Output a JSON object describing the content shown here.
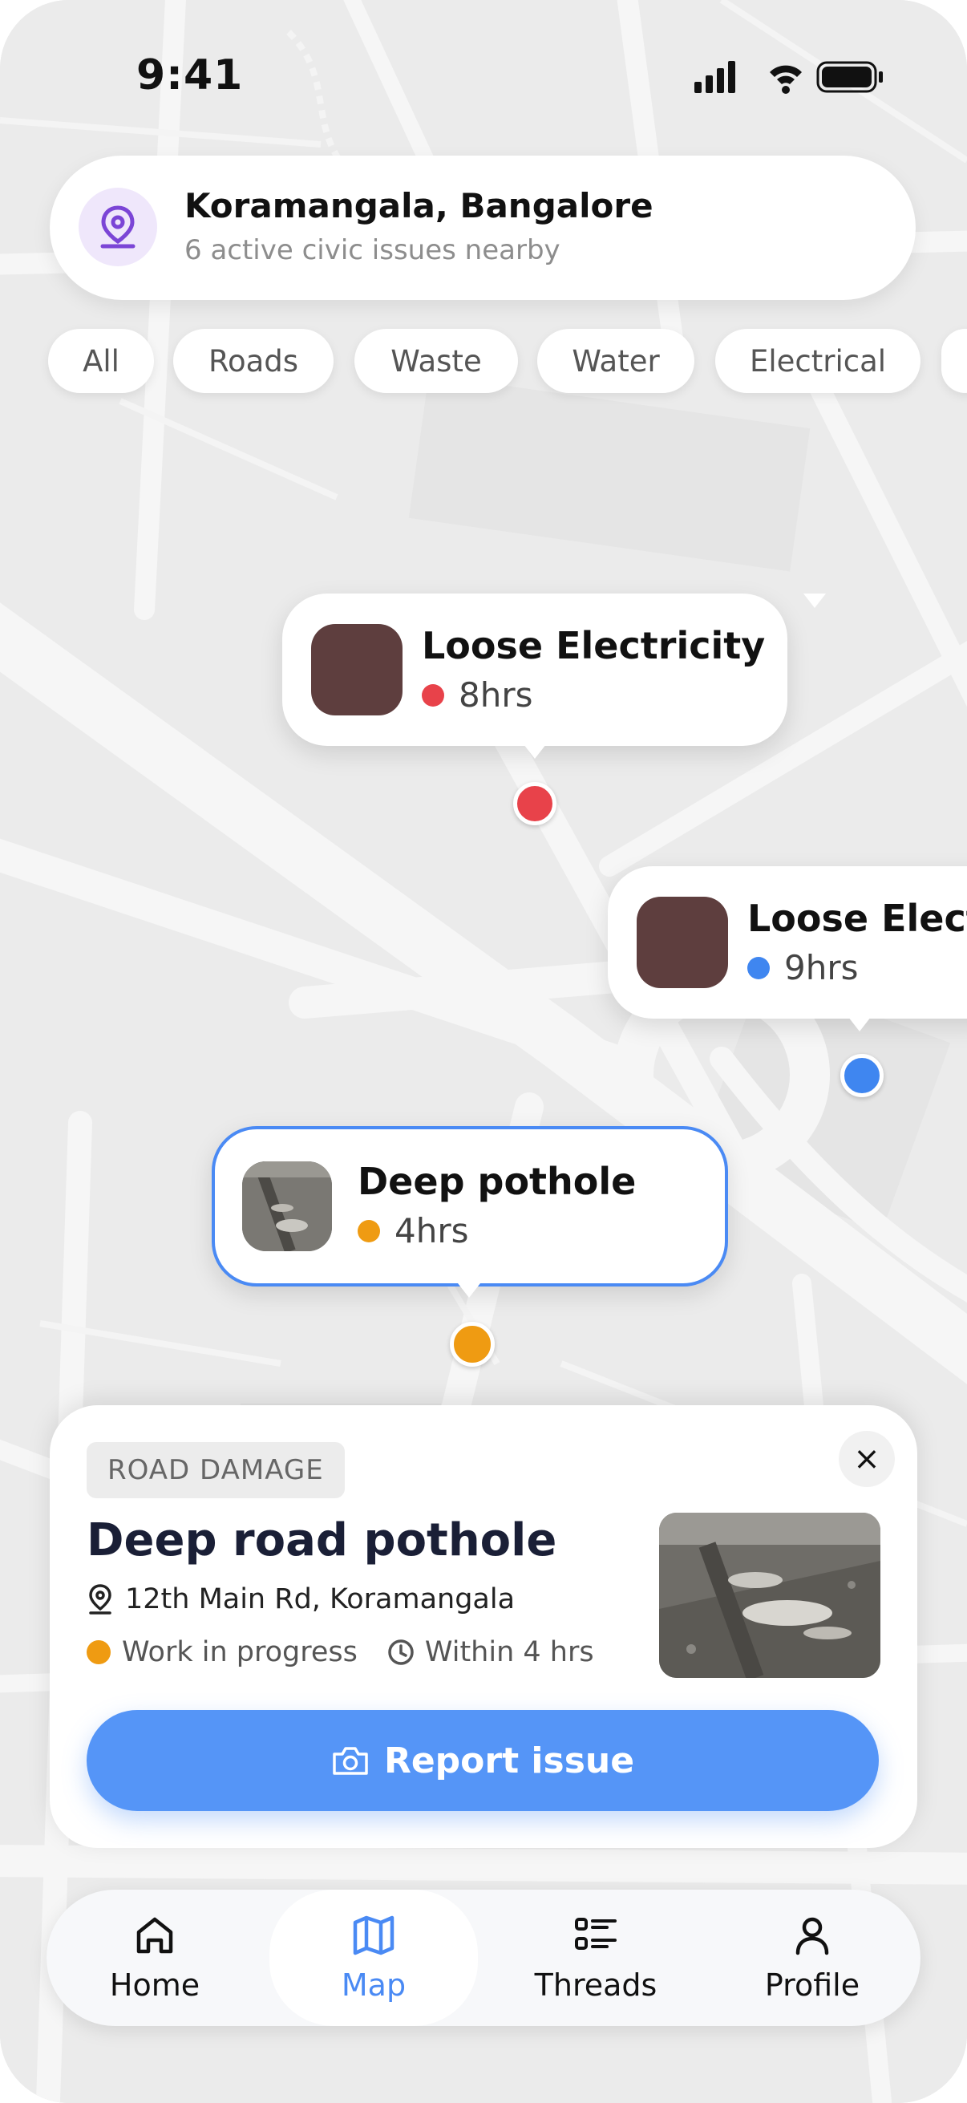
{
  "status_bar": {
    "time": "9:41"
  },
  "location": {
    "title": "Koramangala, Bangalore",
    "subtitle": "6 active civic issues nearby"
  },
  "filters": [
    "All",
    "Roads",
    "Waste",
    "Water",
    "Electrical"
  ],
  "callouts": [
    {
      "title": "Loose Electricity",
      "time": "8hrs",
      "dot_color": "#e8424a"
    },
    {
      "title": "Loose Electr",
      "time": "9hrs",
      "dot_color": "#3f86f0"
    },
    {
      "title": "Deep pothole",
      "time": "4hrs",
      "dot_color": "#ef9b12"
    }
  ],
  "detail": {
    "tag": "ROAD DAMAGE",
    "title": "Deep road pothole",
    "address": "12th Main Rd, Koramangala",
    "status": "Work in progress",
    "status_color": "#ef9b12",
    "eta": "Within 4 hrs",
    "button": "Report issue",
    "close": "×"
  },
  "nav": {
    "items": [
      {
        "label": "Home",
        "icon": "home-icon"
      },
      {
        "label": "Map",
        "icon": "map-icon",
        "active": true
      },
      {
        "label": "Threads",
        "icon": "threads-icon"
      },
      {
        "label": "Profile",
        "icon": "profile-icon"
      }
    ]
  },
  "colors": {
    "accent": "#5595f7",
    "nav_active": "#4a8af4",
    "map_bg": "#e6e6e6"
  }
}
